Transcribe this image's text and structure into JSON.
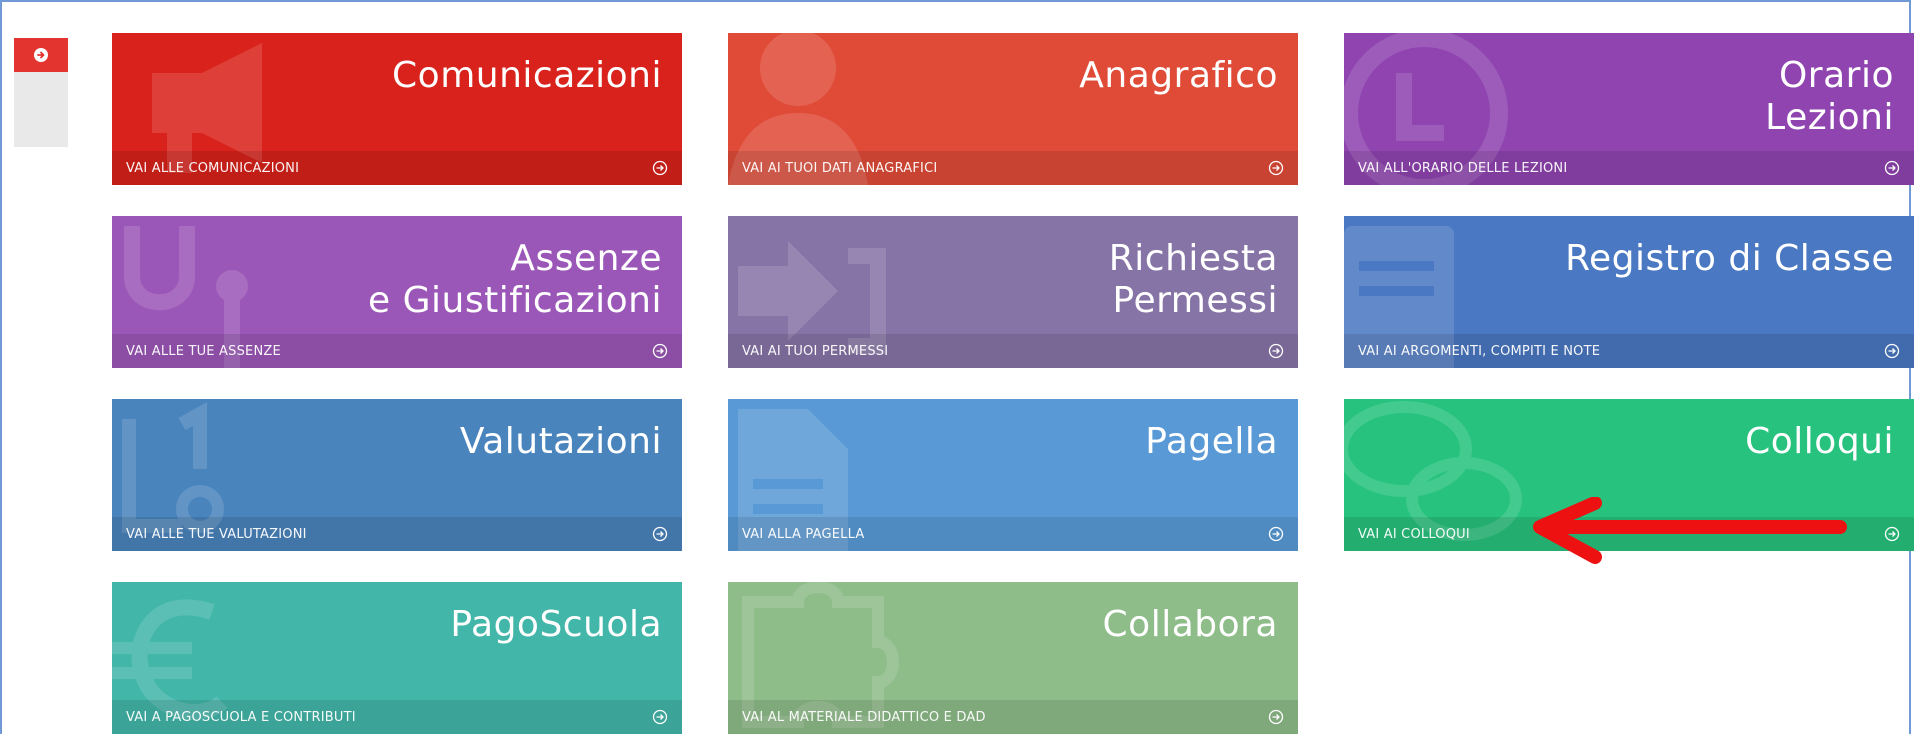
{
  "colors": {
    "comunicazioni": "#d9221b",
    "anagrafico": "#e04b38",
    "orario": "#8f44b0",
    "assenze": "#9b57b7",
    "richiesta": "#8774a6",
    "registro": "#4a78c2",
    "valutazioni": "#4a84bd",
    "pagella": "#599ad6",
    "colloqui": "#27c27d",
    "pagoscuola": "#43b6aa",
    "collabora": "#8ebd8a",
    "annotation_arrow": "#ee1111"
  },
  "tiles": [
    {
      "key": "comunicazioni",
      "title": "Comunicazioni",
      "link": "VAI ALLE COMUNICAZIONI",
      "icon": "megaphone-icon"
    },
    {
      "key": "anagrafico",
      "title": "Anagrafico",
      "link": "VAI AI TUOI DATI ANAGRAFICI",
      "icon": "user-icon"
    },
    {
      "key": "orario",
      "title": "Orario\nLezioni",
      "link": "VAI ALL'ORARIO DELLE LEZIONI",
      "icon": "clock-icon"
    },
    {
      "key": "assenze",
      "title": "Assenze\ne Giustificazioni",
      "link": "VAI ALLE TUE ASSENZE",
      "icon": "stethoscope-icon"
    },
    {
      "key": "richiesta",
      "title": "Richiesta\nPermessi",
      "link": "VAI AI TUOI PERMESSI",
      "icon": "sign-in-icon"
    },
    {
      "key": "registro",
      "title": "Registro di Classe",
      "link": "VAI AI ARGOMENTI, COMPITI E NOTE",
      "icon": "register-icon"
    },
    {
      "key": "valutazioni",
      "title": "Valutazioni",
      "link": "VAI ALLE TUE VALUTAZIONI",
      "icon": "grades-icon"
    },
    {
      "key": "pagella",
      "title": "Pagella",
      "link": "VAI ALLA PAGELLA",
      "icon": "document-icon"
    },
    {
      "key": "colloqui",
      "title": "Colloqui",
      "link": "VAI AI COLLOQUI",
      "icon": "chat-icon"
    },
    {
      "key": "pagoscuola",
      "title": "PagoScuola",
      "link": "VAI A PAGOSCUOLA E CONTRIBUTI",
      "icon": "euro-icon"
    },
    {
      "key": "collabora",
      "title": "Collabora",
      "link": "VAI AL MATERIALE DIDATTICO E DAD",
      "icon": "puzzle-icon"
    }
  ]
}
